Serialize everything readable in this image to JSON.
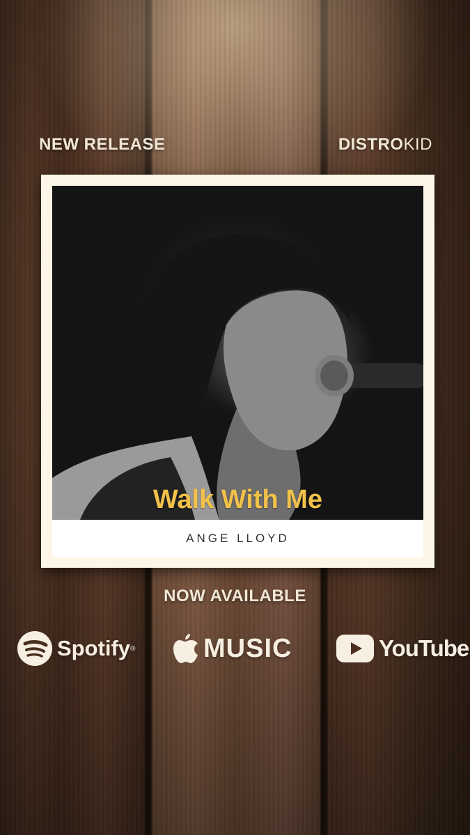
{
  "header": {
    "left_label": "NEW RELEASE",
    "brand_bold": "DISTRO",
    "brand_light": "KID"
  },
  "album": {
    "title": "Walk With Me",
    "artist": "ANGE LLOYD"
  },
  "availability": {
    "label": "NOW AVAILABLE"
  },
  "services": [
    {
      "name": "Spotify",
      "icon": "spotify-icon"
    },
    {
      "name": "MUSIC",
      "icon": "apple-icon"
    },
    {
      "name": "YouTube",
      "icon": "youtube-play-icon"
    }
  ],
  "colors": {
    "title_yellow": "#f2c14a",
    "label_cream": "#f1e7d6",
    "frame_cream": "#fdf6e6",
    "wood_brown": "#5a3a28"
  }
}
